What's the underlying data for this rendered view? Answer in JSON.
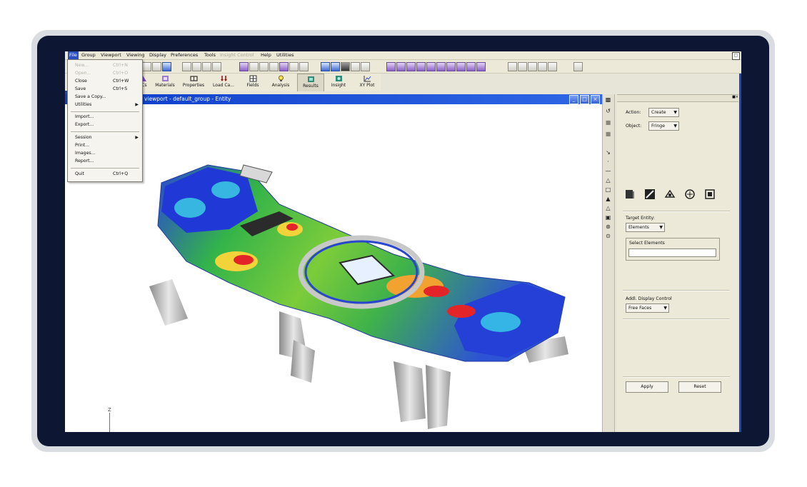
{
  "menubar": {
    "items": [
      {
        "label": "File",
        "active": true
      },
      {
        "label": "Group"
      },
      {
        "label": "Viewport"
      },
      {
        "label": "Viewing"
      },
      {
        "label": "Display"
      },
      {
        "label": "Preferences"
      },
      {
        "label": "Tools"
      },
      {
        "label": "Insight Control",
        "disabled": true
      },
      {
        "label": "Help"
      },
      {
        "label": "Utilities"
      }
    ]
  },
  "file_menu": {
    "items": [
      {
        "label": "New...",
        "shortcut": "Ctrl+N",
        "disabled": true
      },
      {
        "label": "Open...",
        "shortcut": "Ctrl+O",
        "disabled": true
      },
      {
        "label": "Close",
        "shortcut": "Ctrl+W"
      },
      {
        "label": "Save",
        "shortcut": "Ctrl+S"
      },
      {
        "label": "Save a Copy..."
      },
      {
        "label": "Utilities",
        "submenu": true
      },
      {
        "label": "Import..."
      },
      {
        "label": "Export..."
      },
      {
        "label": "Session",
        "submenu": true
      },
      {
        "label": "Print..."
      },
      {
        "label": "Images..."
      },
      {
        "label": "Report..."
      },
      {
        "label": "Quit",
        "shortcut": "Ctrl+Q"
      }
    ]
  },
  "tabs": [
    {
      "label": "BCs",
      "icon": "bcs-icon"
    },
    {
      "label": "Materials",
      "icon": "materials-icon"
    },
    {
      "label": "Properties",
      "icon": "properties-icon"
    },
    {
      "label": "Load Ca...",
      "icon": "load-cases-icon"
    },
    {
      "label": "Fields",
      "icon": "fields-icon"
    },
    {
      "label": "Analysis",
      "icon": "analysis-icon"
    },
    {
      "label": "Results",
      "icon": "results-icon",
      "active": true
    },
    {
      "label": "Insight",
      "icon": "insight-icon"
    },
    {
      "label": "XY Plot",
      "icon": "xy-plot-icon"
    }
  ],
  "viewport": {
    "title": "viewport - default_group - Entity",
    "axis_label": "Z"
  },
  "panel": {
    "action_label": "Action:",
    "action_value": "Create",
    "object_label": "Object:",
    "object_value": "Fringe",
    "target_entity_label": "Target Entity:",
    "target_entity_value": "Elements",
    "select_elements_label": "Select Elements",
    "select_elements_value": "",
    "addl_display_label": "Addl. Display Control",
    "addl_display_value": "Free Faces",
    "apply_label": "Apply",
    "reset_label": "Reset"
  },
  "colors": {
    "titlebar_blue": "#1646d2",
    "fringe_blue": "#1f35d6",
    "fringe_green": "#3fb24a",
    "fringe_red": "#e4262b"
  }
}
